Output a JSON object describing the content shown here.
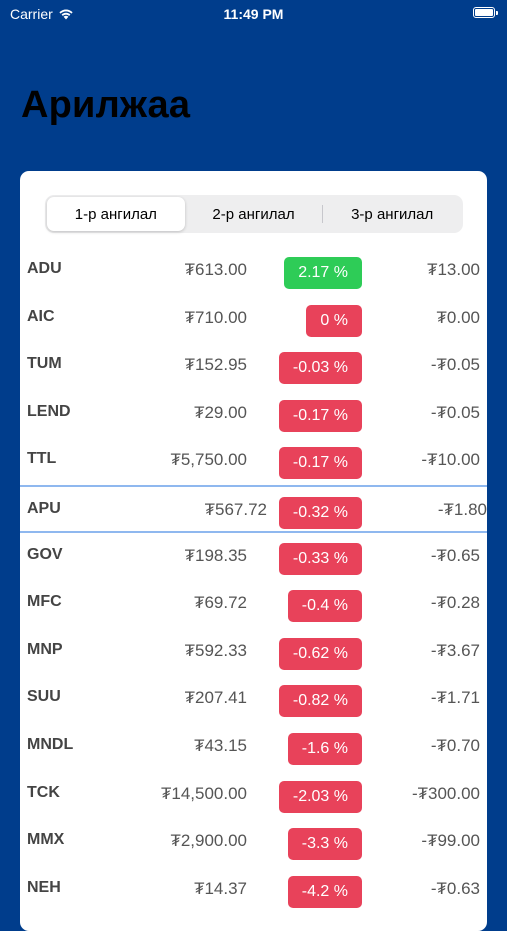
{
  "status_bar": {
    "carrier": "Carrier",
    "time": "11:49 PM"
  },
  "page_title": "Арилжаа",
  "tabs": [
    {
      "label": "1-р ангилал",
      "selected": true
    },
    {
      "label": "2-р ангилал",
      "selected": false
    },
    {
      "label": "3-р ангилал",
      "selected": false
    }
  ],
  "colors": {
    "header_bg": "#003d8c",
    "positive": "#2ecc57",
    "negative": "#e8425a",
    "highlight_border": "#8fb8ef"
  },
  "stocks": [
    {
      "ticker": "ADU",
      "price": "₮613.00",
      "pct": "2.17 %",
      "trend": "up",
      "change": "₮13.00"
    },
    {
      "ticker": "AIC",
      "price": "₮710.00",
      "pct": "0 %",
      "trend": "down",
      "change": "₮0.00"
    },
    {
      "ticker": "TUM",
      "price": "₮152.95",
      "pct": "-0.03 %",
      "trend": "down",
      "change": "-₮0.05"
    },
    {
      "ticker": "LEND",
      "price": "₮29.00",
      "pct": "-0.17 %",
      "trend": "down",
      "change": "-₮0.05"
    },
    {
      "ticker": "TTL",
      "price": "₮5,750.00",
      "pct": "-0.17 %",
      "trend": "down",
      "change": "-₮10.00"
    },
    {
      "ticker": "APU",
      "price": "₮567.72",
      "pct": "-0.32 %",
      "trend": "down",
      "change": "-₮1.80",
      "highlighted": true
    },
    {
      "ticker": "GOV",
      "price": "₮198.35",
      "pct": "-0.33 %",
      "trend": "down",
      "change": "-₮0.65"
    },
    {
      "ticker": "MFC",
      "price": "₮69.72",
      "pct": "-0.4 %",
      "trend": "down",
      "change": "-₮0.28"
    },
    {
      "ticker": "MNP",
      "price": "₮592.33",
      "pct": "-0.62 %",
      "trend": "down",
      "change": "-₮3.67"
    },
    {
      "ticker": "SUU",
      "price": "₮207.41",
      "pct": "-0.82 %",
      "trend": "down",
      "change": "-₮1.71"
    },
    {
      "ticker": "MNDL",
      "price": "₮43.15",
      "pct": "-1.6 %",
      "trend": "down",
      "change": "-₮0.70"
    },
    {
      "ticker": "TCK",
      "price": "₮14,500.00",
      "pct": "-2.03 %",
      "trend": "down",
      "change": "-₮300.00"
    },
    {
      "ticker": "MMX",
      "price": "₮2,900.00",
      "pct": "-3.3 %",
      "trend": "down",
      "change": "-₮99.00"
    },
    {
      "ticker": "NEH",
      "price": "₮14.37",
      "pct": "-4.2 %",
      "trend": "down",
      "change": "-₮0.63"
    }
  ]
}
